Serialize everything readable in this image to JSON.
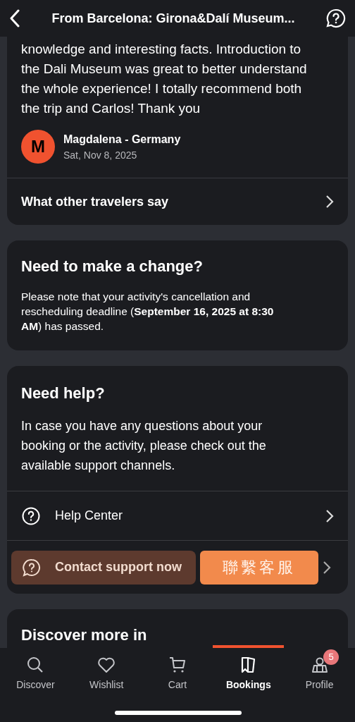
{
  "header": {
    "title": "From Barcelona: Girona&Dalí Museum..."
  },
  "review": {
    "text": "knowledge and interesting facts. Introduction to the Dali Museum was great to better understand the whole experience! I totally recommend both the trip and Carlos! Thank you",
    "avatar_letter": "M",
    "author": "Magdalena - Germany",
    "date": "Sat, Nov 8, 2025",
    "more_link": "What other travelers say"
  },
  "change": {
    "title": "Need to make a change?",
    "text": "Please note that your activity's cancellation and rescheduling deadline (**September 16, 2025 at 8:30 AM**) has passed."
  },
  "help": {
    "title": "Need help?",
    "text": "In case you have any questions about your booking or the activity, please check out the available support channels.",
    "help_center": "Help Center",
    "contact_button": "Contact support now",
    "contact_button_zh": "聯繫客服"
  },
  "discover": {
    "title": "Discover more in"
  },
  "nav": [
    {
      "label": "Discover",
      "selected": false
    },
    {
      "label": "Wishlist",
      "selected": false
    },
    {
      "label": "Cart",
      "selected": false
    },
    {
      "label": "Bookings",
      "selected": true
    },
    {
      "label": "Profile",
      "selected": false,
      "badge": "5"
    }
  ]
}
